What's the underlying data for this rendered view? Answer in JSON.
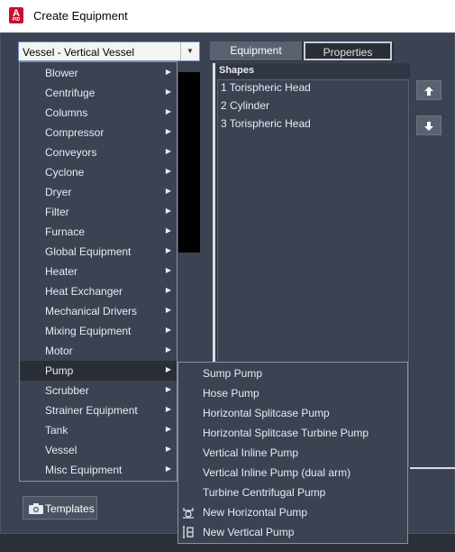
{
  "window": {
    "title": "Create Equipment",
    "app_icon_letter": "A",
    "app_icon_sub": "PID"
  },
  "equipment_type": {
    "selected": "Vessel - Vertical Vessel"
  },
  "tabs": [
    {
      "label": "Equipment"
    },
    {
      "label": "Properties"
    }
  ],
  "shapes": {
    "header": "Shapes",
    "items": [
      "1 Torispheric Head",
      "2 Cylinder",
      "3 Torispheric Head"
    ]
  },
  "move_buttons": {
    "up_icon": "arrow-up-icon",
    "down_icon": "arrow-down-icon"
  },
  "templates_button": {
    "label": "Templates",
    "icon": "camera-icon"
  },
  "category_menu": {
    "active_index": 15,
    "items": [
      "Blower",
      "Centrifuge",
      "Columns",
      "Compressor",
      "Conveyors",
      "Cyclone",
      "Dryer",
      "Filter",
      "Furnace",
      "Global Equipment",
      "Heater",
      "Heat Exchanger",
      "Mechanical Drivers",
      "Mixing Equipment",
      "Motor",
      "Pump",
      "Scrubber",
      "Strainer Equipment",
      "Tank",
      "Vessel",
      "Misc Equipment"
    ]
  },
  "pump_submenu": {
    "items": [
      {
        "label": "Sump Pump",
        "icon": ""
      },
      {
        "label": "Hose Pump",
        "icon": ""
      },
      {
        "label": "Horizontal Splitcase Pump",
        "icon": ""
      },
      {
        "label": "Horizontal Splitcase Turbine Pump",
        "icon": ""
      },
      {
        "label": "Vertical Inline Pump",
        "icon": ""
      },
      {
        "label": "Vertical Inline Pump (dual arm)",
        "icon": ""
      },
      {
        "label": "Turbine Centrifugal Pump",
        "icon": ""
      },
      {
        "label": "New Horizontal Pump",
        "icon": "horizontal-pump-icon"
      },
      {
        "label": "New Vertical Pump",
        "icon": "vertical-pump-icon"
      }
    ]
  }
}
